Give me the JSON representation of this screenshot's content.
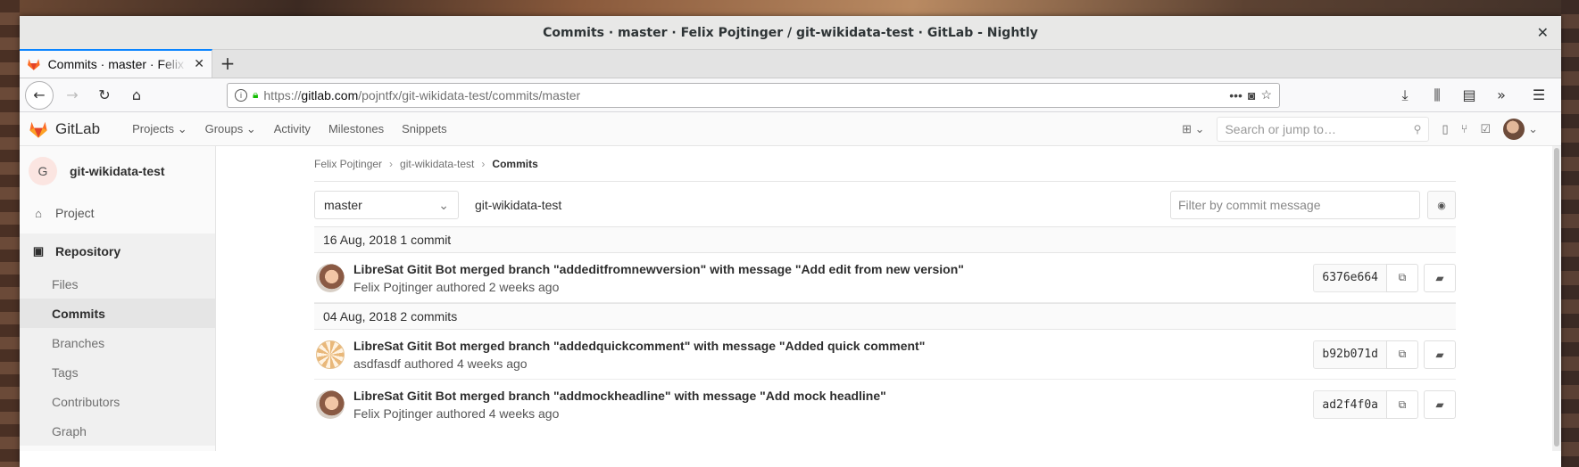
{
  "window": {
    "title": "Commits · master · Felix Pojtinger / git-wikidata-test · GitLab - Nightly"
  },
  "browser": {
    "tab_label": "Commits · master · Felix P",
    "url_prefix": "https://",
    "url_host": "gitlab.com",
    "url_path": "/pojntfx/git-wikidata-test/commits/master"
  },
  "gitlab": {
    "brand": "GitLab",
    "nav": [
      {
        "label": "Projects",
        "dropdown": true
      },
      {
        "label": "Groups",
        "dropdown": true
      },
      {
        "label": "Activity"
      },
      {
        "label": "Milestones"
      },
      {
        "label": "Snippets"
      }
    ],
    "search_placeholder": "Search or jump to…"
  },
  "sidebar": {
    "project_initial": "G",
    "project_name": "git-wikidata-test",
    "project_label": "Project",
    "repository_label": "Repository",
    "sub_items": [
      "Files",
      "Commits",
      "Branches",
      "Tags",
      "Contributors",
      "Graph"
    ]
  },
  "breadcrumb": {
    "owner": "Felix Pojtinger",
    "repo": "git-wikidata-test",
    "current": "Commits"
  },
  "filters": {
    "branch": "master",
    "repo_name": "git-wikidata-test",
    "filter_placeholder": "Filter by commit message"
  },
  "days": [
    {
      "header": "16 Aug, 2018 1 commit",
      "commits": [
        {
          "title": "LibreSat Gitit Bot merged branch \"addeditfromnewversion\" with message \"Add edit from new version\"",
          "meta": "Felix Pojtinger authored 2 weeks ago",
          "sha": "6376e664"
        }
      ]
    },
    {
      "header": "04 Aug, 2018 2 commits",
      "commits": [
        {
          "title": "LibreSat Gitit Bot merged branch \"addedquickcomment\" with message \"Added quick comment\"",
          "meta": "asdfasdf authored 4 weeks ago",
          "sha": "b92b071d"
        },
        {
          "title": "LibreSat Gitit Bot merged branch \"addmockheadline\" with message \"Add mock headline\"",
          "meta": "Felix Pojtinger authored 4 weeks ago",
          "sha": "ad2f4f0a"
        }
      ]
    }
  ],
  "colors": {
    "accent": "#0a84ff",
    "gitlab_orange": "#fc6d26"
  }
}
